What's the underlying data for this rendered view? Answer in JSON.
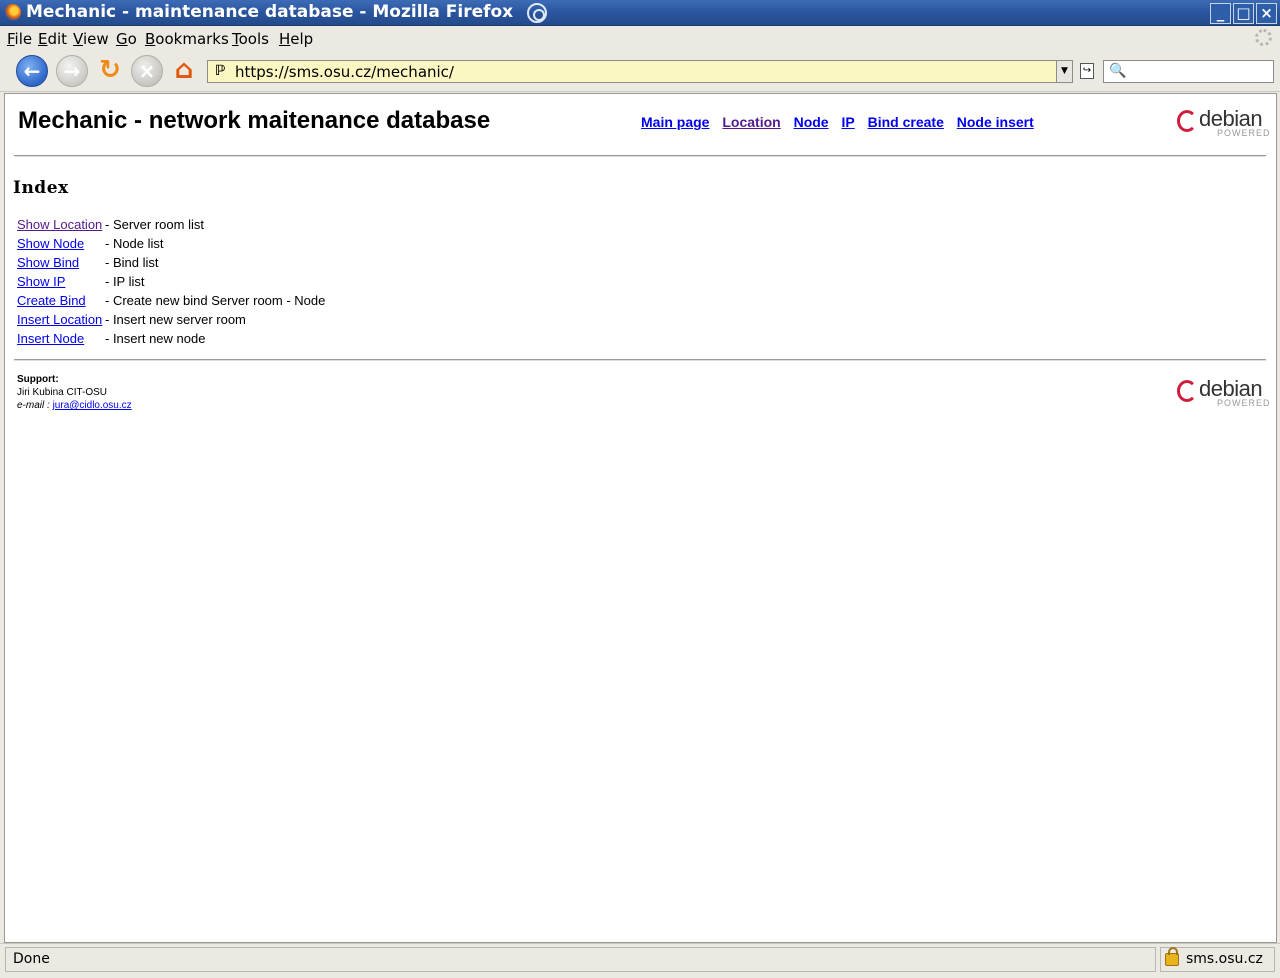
{
  "window": {
    "title": "Mechanic - maintenance database - Mozilla Firefox",
    "controls": [
      "_",
      "□",
      "×"
    ]
  },
  "menubar": {
    "items": [
      {
        "label": "File",
        "accel": "F",
        "rest": "ile"
      },
      {
        "label": "Edit",
        "accel": "E",
        "rest": "dit"
      },
      {
        "label": "View",
        "accel": "V",
        "rest": "iew"
      },
      {
        "label": "Go",
        "accel": "G",
        "rest": "o"
      },
      {
        "label": "Bookmarks",
        "accel": "B",
        "rest": "ookmarks"
      },
      {
        "label": "Tools",
        "accel": "T",
        "rest": "ools"
      },
      {
        "label": "Help",
        "accel": "H",
        "rest": "elp"
      }
    ]
  },
  "toolbar": {
    "url": "https://sms.osu.cz/mechanic/",
    "search_placeholder": "",
    "icons": {
      "back": "back-arrow-icon",
      "forward": "forward-arrow-icon",
      "reload": "reload-icon",
      "stop": "stop-icon",
      "home": "home-icon"
    }
  },
  "page": {
    "header": "Mechanic - network maitenance database",
    "nav": [
      {
        "label": "Main page",
        "visited": false
      },
      {
        "label": "Location",
        "visited": true
      },
      {
        "label": "Node",
        "visited": false
      },
      {
        "label": "IP",
        "visited": false
      },
      {
        "label": "Bind create",
        "visited": false
      },
      {
        "label": "Node insert",
        "visited": false
      }
    ],
    "debian_logo": {
      "word": "debian",
      "sub": "POWERED"
    },
    "index_heading": "Index",
    "links": [
      {
        "label": "Show Location",
        "desc": "- Server room list",
        "visited": true
      },
      {
        "label": "Show Node",
        "desc": "- Node list",
        "visited": false
      },
      {
        "label": "Show Bind",
        "desc": "- Bind list",
        "visited": false
      },
      {
        "label": "Show IP",
        "desc": "- IP list",
        "visited": false
      },
      {
        "label": "Create Bind",
        "desc": "- Create new bind Server room - Node",
        "visited": false
      },
      {
        "label": "Insert Location",
        "desc": "- Insert new server room",
        "visited": false
      },
      {
        "label": "Insert Node",
        "desc": "- Insert new node",
        "visited": false
      }
    ],
    "support": {
      "label": "Support:",
      "name": "Jiri Kubina CIT-OSU",
      "email_label": "e-mail :",
      "email": "jura@cidlo.osu.cz"
    }
  },
  "statusbar": {
    "status": "Done",
    "host": "sms.osu.cz"
  },
  "colors": {
    "link": "#0000ee",
    "visited": "#551a8b",
    "urlbar_bg": "#fbf7c2",
    "titlebar": "#2a559e",
    "debian_red": "#cf1e3d"
  }
}
